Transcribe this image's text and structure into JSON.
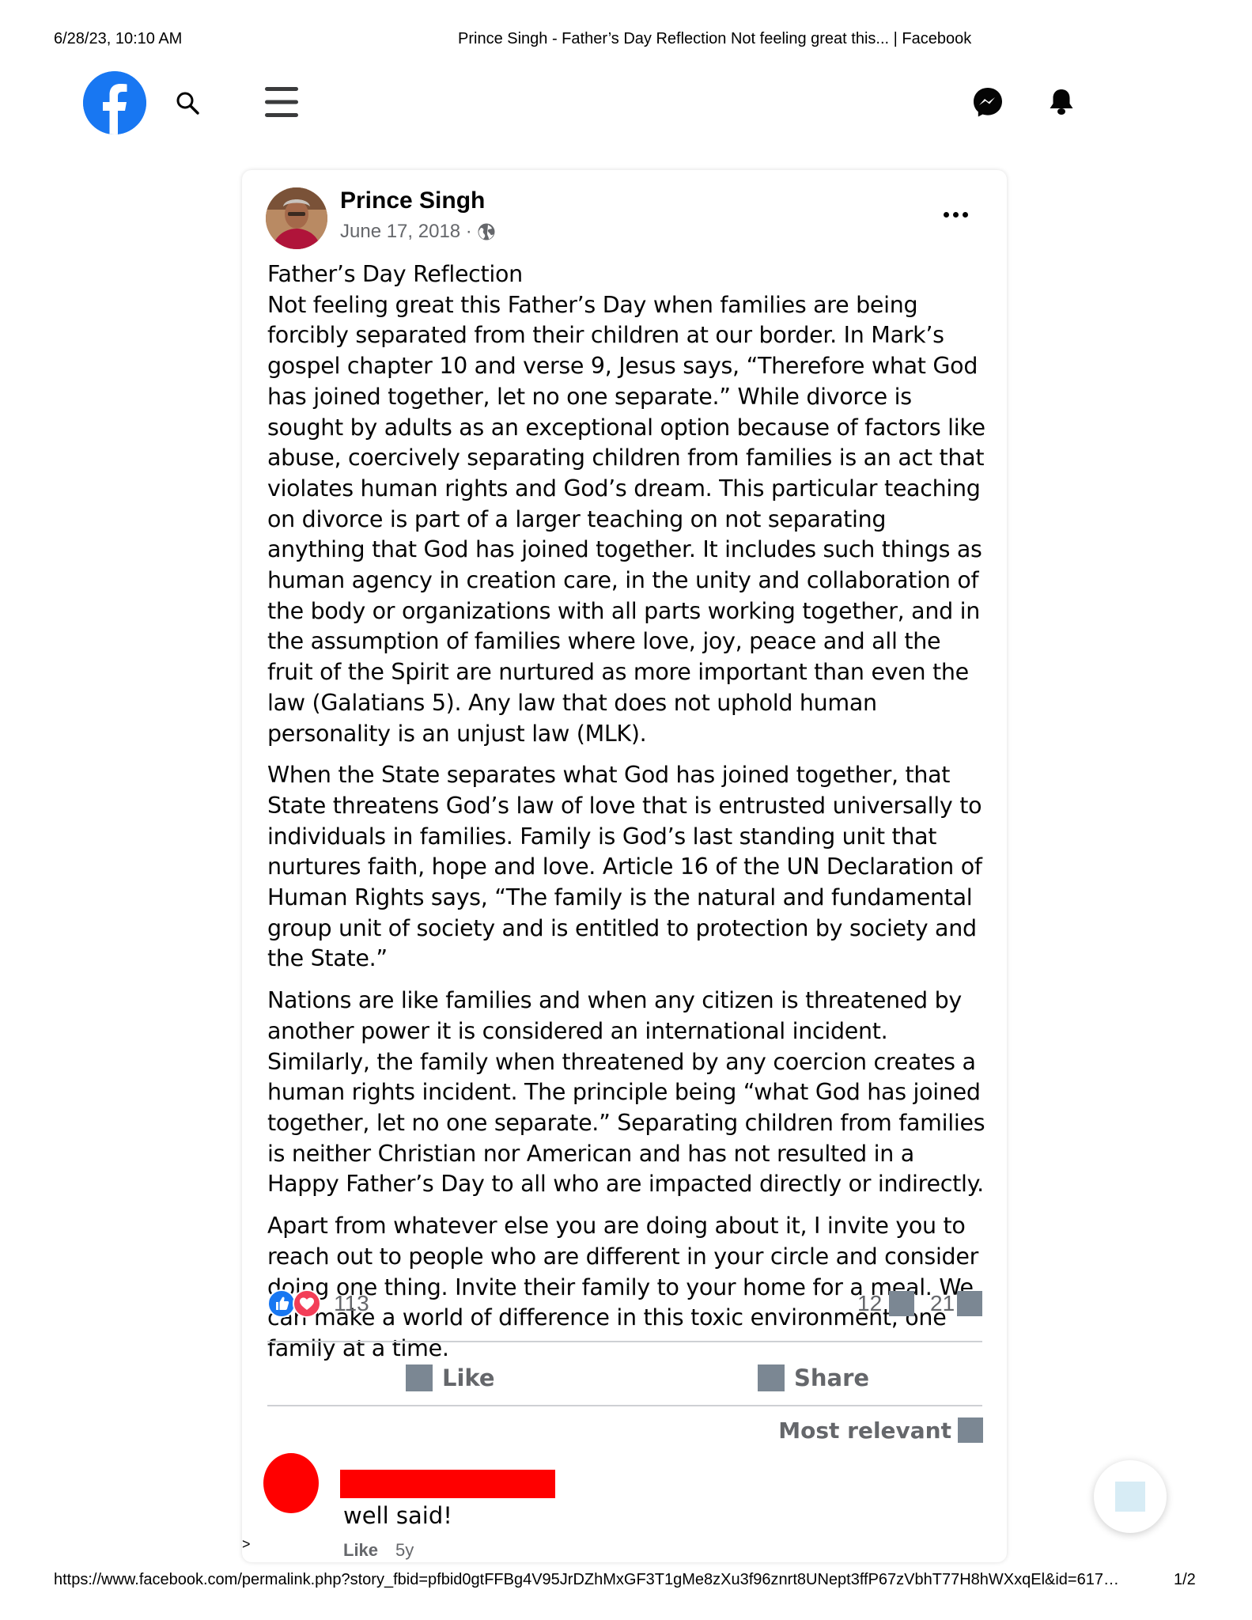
{
  "print_header": {
    "date": "6/28/23, 10:10 AM",
    "page_title": "Prince Singh - Father’s Day Reflection Not feeling great this... | Facebook"
  },
  "topbar": {
    "icons": [
      "facebook-logo",
      "search-icon",
      "menu-icon",
      "messenger-icon",
      "notifications-bell-icon"
    ],
    "brand_color": "#1877f2"
  },
  "post": {
    "author": "Prince Singh",
    "date": "June 17, 2018 ·",
    "privacy_icon": "globe-icon",
    "heading": "Father’s Day Reflection",
    "paragraphs": [
      "Not feeling great this Father’s Day when families are being forcibly separated from their children at our border. In Mark’s gospel chapter 10 and verse 9, Jesus says, “Therefore what God has joined together, let no one separate.” While divorce is sought by adults as an exceptional option because of factors like abuse, coercively separating children from families is an act that violates human rights and God’s dream. This particular teaching on divorce is part of a larger teaching on not separating anything that God has joined together. It includes such things as human agency in creation care, in the unity and collaboration of the body or organizations with all parts working together, and in the assumption of families where love, joy, peace and all the fruit of the Spirit are nurtured as more important than even the law (Galatians 5). Any law that does not uphold human personality is an unjust law (MLK).",
      "When the State separates what God has joined together, that State threatens God’s law of love that is entrusted universally to individuals in families. Family is God’s last standing unit that nurtures faith, hope and love. Article 16 of the UN Declaration of Human Rights says, “The family is the natural and fundamental group unit of society and is entitled to protection by society and the State.”",
      "Nations are like families and when any citizen is threatened by another power it is considered an international incident. Similarly, the family when threatened by any coercion creates a human rights incident. The principle being “what God has joined together, let no one separate.” Separating children from families is neither Christian nor American and has not resulted in a Happy Father’s Day to all who are impacted directly or indirectly.",
      "Apart from whatever else you are doing about it, I invite you to reach out to people who are different in your circle and consider doing one thing. Invite their family to your home for a meal. We can make a world of difference in this toxic environment, one family at a time."
    ],
    "reaction_count": "113",
    "comment_count": "12",
    "share_count": "21",
    "like_label": "Like",
    "share_label": "Share",
    "sort_label": "Most relevant"
  },
  "comment": {
    "text": "well said!",
    "like_label": "Like",
    "time": "5y"
  },
  "misc": {
    "marker": ">"
  },
  "print_footer": {
    "url": "https://www.facebook.com/permalink.php?story_fbid=pfbid0gtFFBg4V95JrDZhMxGF3T1gMe8zXu3f96znrt8UNept3ffP67zVbhT77H8hWXxqEl&id=617…",
    "page": "1/2"
  }
}
